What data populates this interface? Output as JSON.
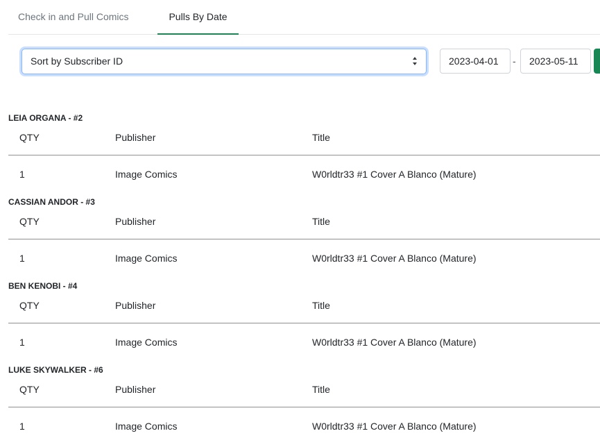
{
  "tabs": [
    {
      "label": "Check in and Pull Comics"
    },
    {
      "label": "Pulls By Date"
    }
  ],
  "filters": {
    "sort_label": "Sort by Subscriber ID",
    "start_date": "2023-04-01",
    "end_date": "2023-05-11",
    "separator": "-"
  },
  "colors": {
    "accent": "#198754",
    "focus": "#86b7fe"
  },
  "table_headers": {
    "qty": "QTY",
    "publisher": "Publisher",
    "title": "Title"
  },
  "subscribers": [
    {
      "name": "LEIA ORGANA - #2",
      "rows": [
        {
          "qty": "1",
          "publisher": "Image Comics",
          "title": "W0rldtr33 #1 Cover A Blanco (Mature)"
        }
      ]
    },
    {
      "name": "CASSIAN ANDOR - #3",
      "rows": [
        {
          "qty": "1",
          "publisher": "Image Comics",
          "title": "W0rldtr33 #1 Cover A Blanco (Mature)"
        }
      ]
    },
    {
      "name": "BEN KENOBI - #4",
      "rows": [
        {
          "qty": "1",
          "publisher": "Image Comics",
          "title": "W0rldtr33 #1 Cover A Blanco (Mature)"
        }
      ]
    },
    {
      "name": "LUKE SKYWALKER - #6",
      "rows": [
        {
          "qty": "1",
          "publisher": "Image Comics",
          "title": "W0rldtr33 #1 Cover A Blanco (Mature)"
        }
      ]
    }
  ]
}
